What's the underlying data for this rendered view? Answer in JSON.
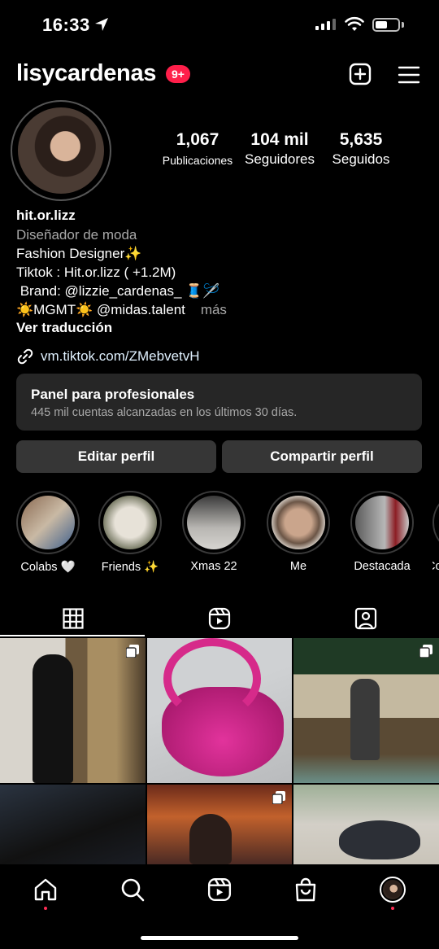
{
  "status_bar": {
    "time": "16:33"
  },
  "header": {
    "username": "lisycardenas",
    "notification_badge": "9+"
  },
  "stats": [
    {
      "value": "1,067",
      "label": "Publicaciones"
    },
    {
      "value": "104 mil",
      "label": "Seguidores"
    },
    {
      "value": "5,635",
      "label": "Seguidos"
    }
  ],
  "bio": {
    "name": "hit.or.lizz",
    "category": "Diseñador de moda",
    "lines": [
      "Fashion Designer✨",
      "Tiktok : Hit.or.lizz ( +1.2M)",
      " Brand: @lizzie_cardenas_ 🧵🪡",
      "☀️MGMT☀️ @midas.talent"
    ],
    "more": "más",
    "translate": "Ver traducción",
    "link": "vm.tiktok.com/ZMebvetvH"
  },
  "pro_panel": {
    "title": "Panel para profesionales",
    "subtitle": "445 mil cuentas alcanzadas en los últimos 30 días."
  },
  "buttons": {
    "edit": "Editar perfil",
    "share": "Compartir perfil"
  },
  "highlights": [
    {
      "label": "Colabs 🤍"
    },
    {
      "label": "Friends ✨"
    },
    {
      "label": "Xmas 22"
    },
    {
      "label": "Me"
    },
    {
      "label": "Destacada"
    },
    {
      "label": "Co"
    }
  ],
  "colors": {
    "badge": "#ff1f4a",
    "panel": "#262626",
    "button": "#363636",
    "link": "#e0f1ff"
  }
}
